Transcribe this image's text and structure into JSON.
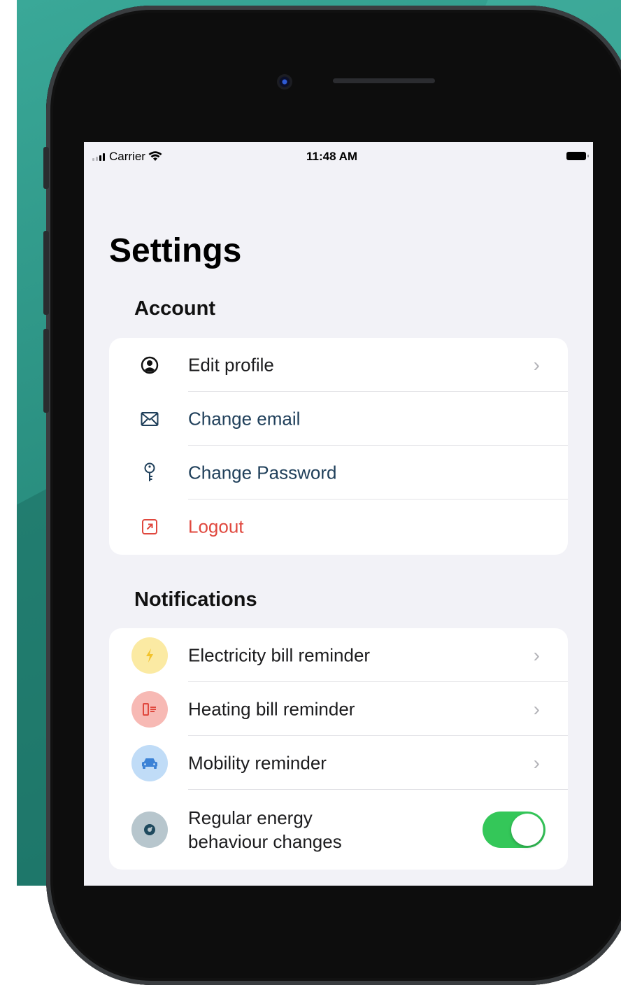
{
  "status_bar": {
    "carrier": "Carrier",
    "time": "11:48 AM"
  },
  "page": {
    "title": "Settings"
  },
  "account": {
    "title": "Account",
    "items": [
      {
        "label": "Edit profile",
        "icon": "person-circle-icon",
        "chevron": true
      },
      {
        "label": "Change email",
        "icon": "envelope-icon",
        "color": "#1f3f5a"
      },
      {
        "label": "Change Password",
        "icon": "key-icon",
        "color": "#1f3f5a"
      },
      {
        "label": "Logout",
        "icon": "logout-icon",
        "color": "#e0483e"
      }
    ]
  },
  "notifications": {
    "title": "Notifications",
    "items": [
      {
        "label": "Electricity bill reminder",
        "icon": "lightning-icon",
        "icon_bg": "#fbeaa3"
      },
      {
        "label": "Heating bill reminder",
        "icon": "radiator-icon",
        "icon_bg": "#f7b9b4"
      },
      {
        "label": "Mobility reminder",
        "icon": "car-icon",
        "icon_bg": "#c0dcf7"
      },
      {
        "label": "Regular energy behaviour changes",
        "label_line1": "Regular energy",
        "label_line2": "behaviour changes",
        "icon": "gauge-icon",
        "icon_bg": "#b7c6cd",
        "toggle_on": true
      }
    ]
  },
  "colors": {
    "toggle_on": "#34c759",
    "logout": "#e0483e",
    "link": "#1f3f5a"
  }
}
